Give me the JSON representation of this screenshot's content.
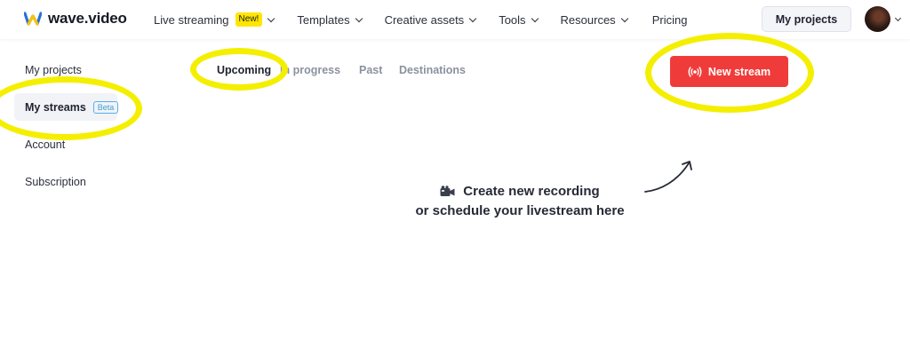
{
  "header": {
    "logo_text": "wave.video",
    "nav": [
      {
        "label": "Live streaming",
        "badge": "New!",
        "has_dropdown": true
      },
      {
        "label": "Templates",
        "has_dropdown": true
      },
      {
        "label": "Creative assets",
        "has_dropdown": true
      },
      {
        "label": "Tools",
        "has_dropdown": true
      },
      {
        "label": "Resources",
        "has_dropdown": true
      },
      {
        "label": "Pricing",
        "has_dropdown": false
      }
    ],
    "my_projects_label": "My projects",
    "avatar_icon": "user-avatar"
  },
  "sidebar": {
    "items": [
      {
        "label": "My projects"
      },
      {
        "label": "My streams",
        "badge": "Beta",
        "active": true
      },
      {
        "label": "Account"
      },
      {
        "label": "Subscription"
      }
    ]
  },
  "tabs": [
    {
      "label": "Upcoming",
      "active": true
    },
    {
      "label": "In progress"
    },
    {
      "label": "Past"
    },
    {
      "label": "Destinations"
    }
  ],
  "new_stream": {
    "label": "New stream",
    "icon": "broadcast-icon",
    "color": "#ef3c3a"
  },
  "empty_state": {
    "icon": "video-camera-icon",
    "line1": "Create new recording",
    "line2": "or schedule your livestream here"
  },
  "colors": {
    "highlight": "#f4ef00",
    "accent_red": "#ef3c3a",
    "beta_blue": "#3f9fd9",
    "new_badge": "#ffe600"
  }
}
